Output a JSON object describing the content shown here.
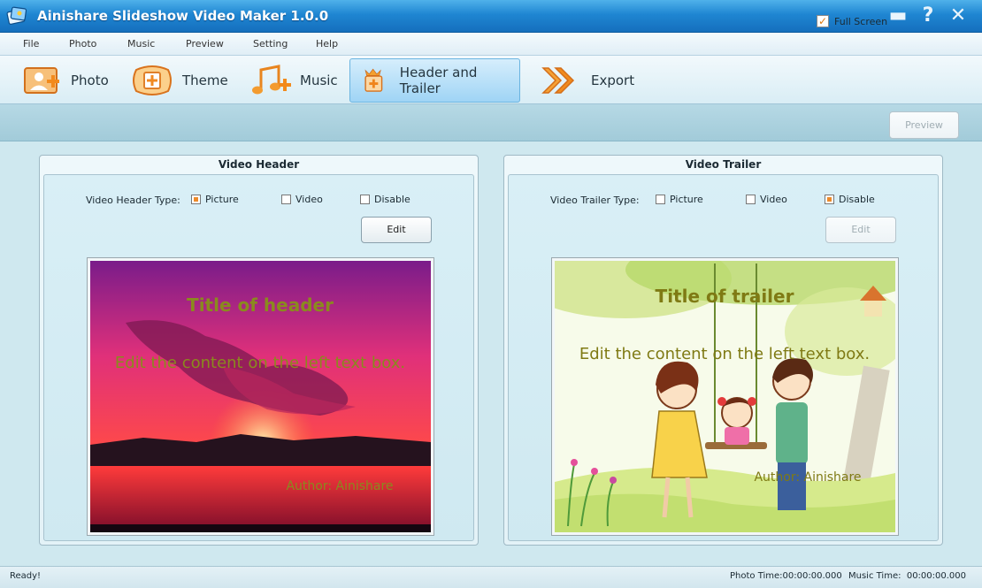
{
  "window": {
    "title": "Ainishare Slideshow Video Maker 1.0.0"
  },
  "menu": [
    "File",
    "Photo",
    "Music",
    "Preview",
    "Setting",
    "Help"
  ],
  "toolbar": [
    {
      "label": "Photo"
    },
    {
      "label": "Theme"
    },
    {
      "label": "Music"
    },
    {
      "label": "Header and Trailer"
    },
    {
      "label": "Export"
    }
  ],
  "options": {
    "fullscreen_label": "Full Screen",
    "fullscreen_checked": true,
    "preview_label": "Preview"
  },
  "header_panel": {
    "title": "Video Header",
    "type_label": "Video Header Type:",
    "types": [
      "Picture",
      "Video",
      "Disable"
    ],
    "selected": "Picture",
    "edit_label": "Edit",
    "preview": {
      "title": "Title of header",
      "content": "Edit the content on the left text box.",
      "author": "Author: Ainishare"
    }
  },
  "trailer_panel": {
    "title": "Video Trailer",
    "type_label": "Video Trailer Type:",
    "types": [
      "Picture",
      "Video",
      "Disable"
    ],
    "selected": "Disable",
    "edit_label": "Edit",
    "preview": {
      "title": "Title of trailer",
      "content": "Edit the content on the left text box.",
      "author": "Author: Ainishare"
    }
  },
  "status": {
    "text": "Ready!",
    "photo_time": "Photo Time:00:00:00.000",
    "music_time": "Music Time:  00:00:00.000"
  },
  "colors": {
    "accent": "#ec8a2a",
    "titlebar": "#1f86d2",
    "overlay_text": "#8a8a1e"
  }
}
